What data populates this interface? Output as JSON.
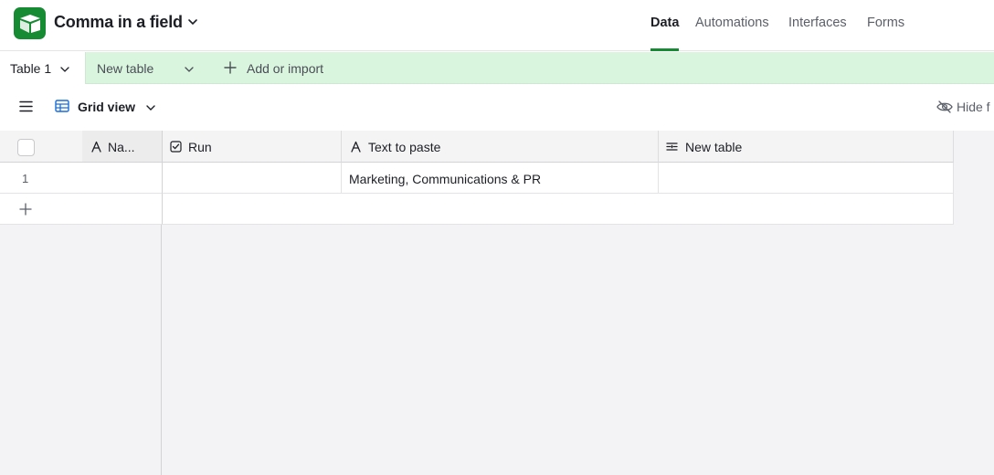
{
  "header": {
    "base_title": "Comma in a field",
    "nav": [
      {
        "label": "Data",
        "active": true
      },
      {
        "label": "Automations",
        "active": false
      },
      {
        "label": "Interfaces",
        "active": false
      },
      {
        "label": "Forms",
        "active": false
      }
    ]
  },
  "tabs": {
    "active": "Table 1",
    "other": "New table",
    "add_label": "Add or import"
  },
  "viewbar": {
    "view_name": "Grid view",
    "hide_label": "Hide f"
  },
  "grid": {
    "columns": [
      {
        "name": "Na...",
        "icon": "text-type-icon"
      },
      {
        "name": "Run",
        "icon": "checkbox-type-icon"
      },
      {
        "name": "Text to paste",
        "icon": "text-type-icon"
      },
      {
        "name": "New table",
        "icon": "link-type-icon"
      }
    ],
    "rows": [
      {
        "number": "1",
        "cells": [
          "",
          "",
          "Marketing, Communications & PR",
          ""
        ]
      }
    ]
  },
  "colors": {
    "brand": "#178a34",
    "tabbar": "#daf5de",
    "grid_background": "#f3f3f5"
  }
}
